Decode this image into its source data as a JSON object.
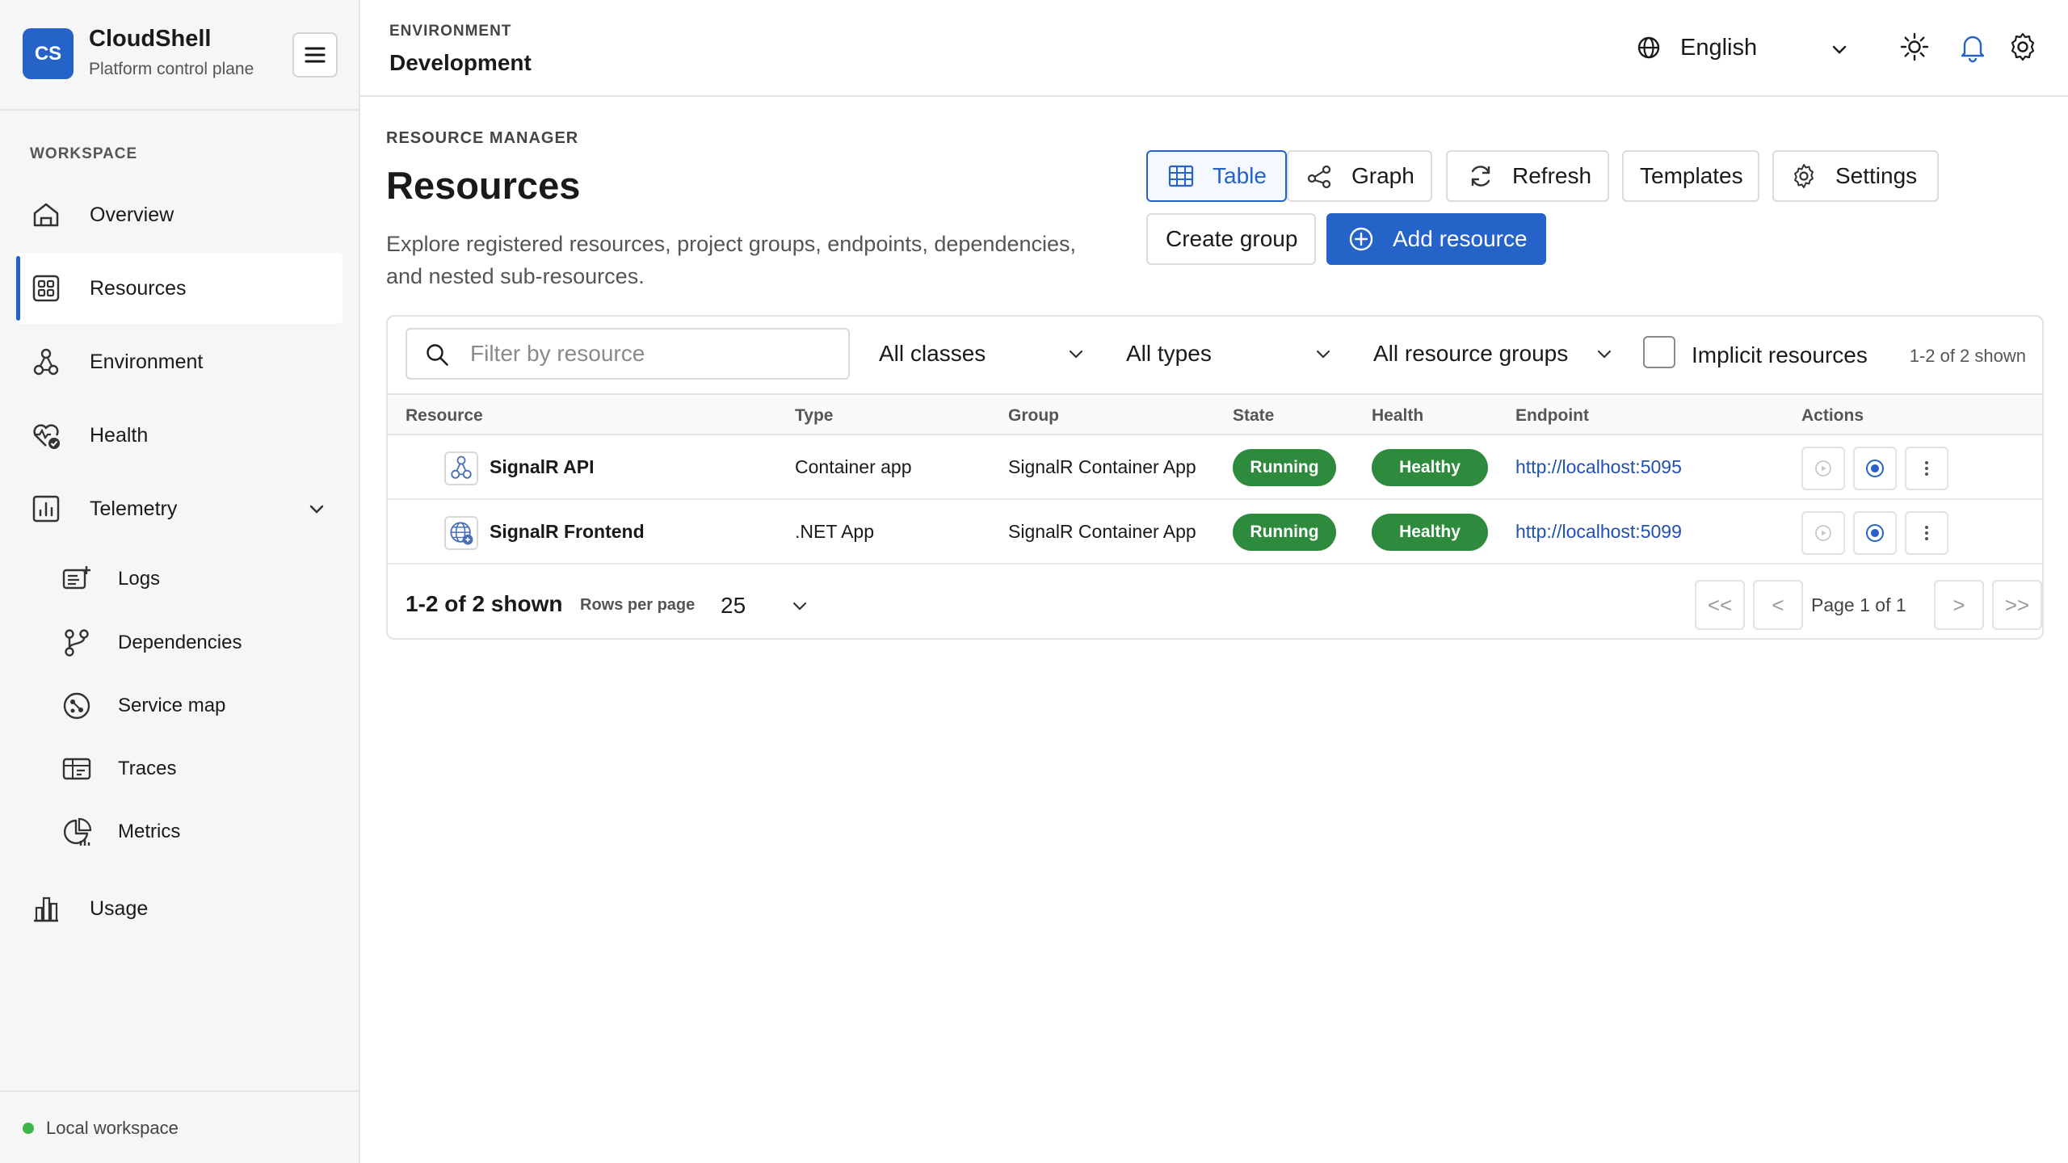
{
  "brand": {
    "logo": "CS",
    "name": "CloudShell",
    "subtitle": "Platform control plane"
  },
  "sidebar": {
    "section_label": "WORKSPACE",
    "items": [
      {
        "label": "Overview",
        "icon": "home-icon"
      },
      {
        "label": "Resources",
        "icon": "grid-icon",
        "active": true
      },
      {
        "label": "Environment",
        "icon": "environment-icon"
      },
      {
        "label": "Health",
        "icon": "health-icon"
      },
      {
        "label": "Telemetry",
        "icon": "chart-icon",
        "expanded": true
      },
      {
        "label": "Usage",
        "icon": "bar-chart-icon"
      }
    ],
    "telemetry_items": [
      {
        "label": "Logs",
        "icon": "logs-icon"
      },
      {
        "label": "Dependencies",
        "icon": "dependencies-icon"
      },
      {
        "label": "Service map",
        "icon": "service-map-icon"
      },
      {
        "label": "Traces",
        "icon": "traces-icon"
      },
      {
        "label": "Metrics",
        "icon": "metrics-icon"
      }
    ],
    "footer": {
      "label": "Local workspace",
      "status_color": "#3bb54a"
    }
  },
  "header": {
    "env_label": "ENVIRONMENT",
    "env_value": "Development",
    "language": "English"
  },
  "main": {
    "breadcrumb": "RESOURCE MANAGER",
    "title": "Resources",
    "description": "Explore registered resources, project groups, endpoints, dependencies, and nested sub-resources.",
    "toolbar": {
      "table": "Table",
      "graph": "Graph",
      "refresh": "Refresh",
      "templates": "Templates",
      "settings": "Settings",
      "create_group": "Create group",
      "add_resource": "Add resource"
    },
    "filters": {
      "search_placeholder": "Filter by resource",
      "search_value": "",
      "classes": "All classes",
      "types": "All types",
      "groups": "All resource groups",
      "implicit_label": "Implicit resources",
      "implicit_checked": false,
      "count": "1-2 of 2 shown"
    },
    "table": {
      "columns": [
        "Resource",
        "Type",
        "Group",
        "State",
        "Health",
        "Endpoint",
        "Actions"
      ],
      "rows": [
        {
          "name": "SignalR API",
          "icon": "container-app-icon",
          "type": "Container app",
          "group": "SignalR Container App",
          "state": "Running",
          "health": "Healthy",
          "endpoint": "http://localhost:5095"
        },
        {
          "name": "SignalR Frontend",
          "icon": "web-app-icon",
          "type": ".NET App",
          "group": "SignalR Container App",
          "state": "Running",
          "health": "Healthy",
          "endpoint": "http://localhost:5099"
        }
      ]
    },
    "pagination": {
      "count": "1-2 of 2 shown",
      "rows_per_page_label": "Rows per page",
      "rows_per_page": "25",
      "first": "<<",
      "prev": "<",
      "page_text": "Page 1 of 1",
      "next": ">",
      "last": ">>"
    }
  },
  "colors": {
    "accent": "#2563c9",
    "status_green": "#2e8b3e",
    "link": "#2050b0"
  }
}
